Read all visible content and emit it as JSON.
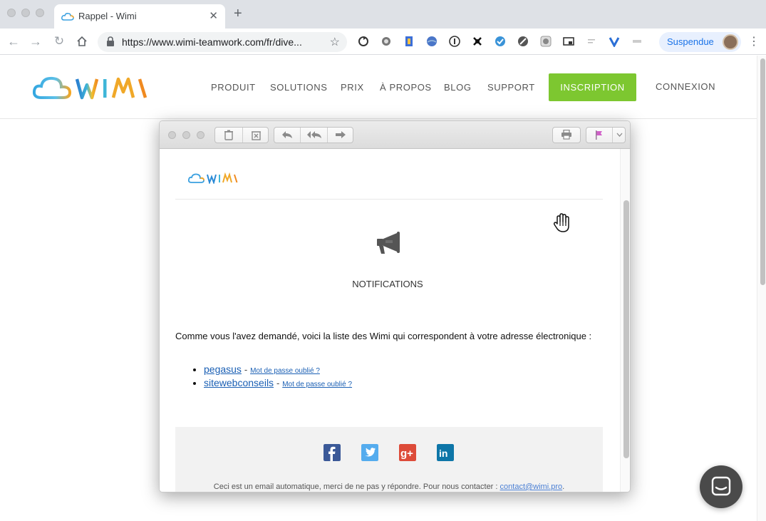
{
  "browser": {
    "tab_title": "Rappel - Wimi",
    "url": "https://www.wimi-teamwork.com/fr/dive...",
    "profile_label": "Suspendue"
  },
  "site": {
    "nav": [
      "PRODUIT",
      "SOLUTIONS",
      "PRIX",
      "À PROPOS",
      "BLOG",
      "SUPPORT"
    ],
    "cta": "INSCRIPTION",
    "login": "CONNEXION",
    "colors": {
      "cta": "#7dc730"
    }
  },
  "email": {
    "section_title": "NOTIFICATIONS",
    "intro": "Comme vous l'avez demandé, voici la liste des Wimi qui correspondent à votre adresse électronique :",
    "wimis": [
      {
        "name": "pegasus",
        "separator": "-",
        "forgot": "Mot de passe oublié ?"
      },
      {
        "name": "sitewebconseils",
        "separator": "-",
        "forgot": "Mot de passe oublié ?"
      }
    ],
    "footer_text": "Ceci est un email automatique, merci de ne pas y répondre. Pour nous contacter :",
    "footer_link": "contact@wimi.pro",
    "footer_period": ".",
    "social": [
      "facebook-icon",
      "twitter-icon",
      "google-plus-icon",
      "linkedin-icon"
    ]
  }
}
